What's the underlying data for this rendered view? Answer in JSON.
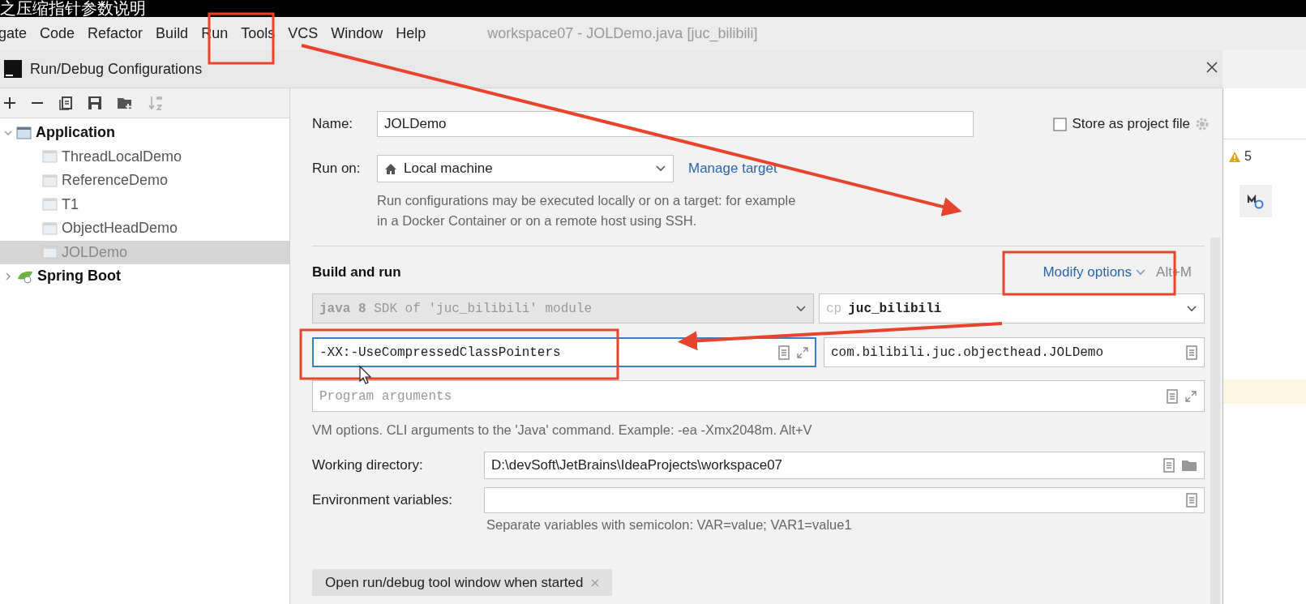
{
  "caption": "之压缩指针参数说明",
  "menu": [
    "gate",
    "Code",
    "Refactor",
    "Build",
    "Run",
    "Tools",
    "VCS",
    "Window",
    "Help"
  ],
  "ide_title": "workspace07 - JOLDemo.java [juc_bilibili]",
  "dialog": {
    "title": "Run/Debug Configurations"
  },
  "tree": [
    {
      "label": "Application",
      "kind": "app",
      "expanded": true,
      "selected": false,
      "children": [
        {
          "label": "ThreadLocalDemo",
          "selected": false
        },
        {
          "label": "ReferenceDemo",
          "selected": false
        },
        {
          "label": "T1",
          "selected": false
        },
        {
          "label": "ObjectHeadDemo",
          "selected": false
        },
        {
          "label": "JOLDemo",
          "selected": true
        }
      ]
    },
    {
      "label": "Spring Boot",
      "kind": "spring",
      "expanded": false,
      "selected": false
    }
  ],
  "form": {
    "name_label": "Name:",
    "name_value": "JOLDemo",
    "store_label": "Store as project file",
    "store_checked": false,
    "run_on_label": "Run on:",
    "run_on_value": "Local machine",
    "manage_link": "Manage target",
    "run_on_hint": "Run configurations may be executed locally or on a target: for example in a Docker Container or on a remote host using SSH.",
    "section": "Build and run",
    "modify_options": "Modify options",
    "modify_shortcut": "Alt+M",
    "sdk": "**java 8** SDK of 'juc_bilibili' module",
    "cp_prefix": "cp",
    "cp_value": "juc_bilibili",
    "vm_options": "-XX:-UseCompressedClassPointers",
    "main_class": "com.bilibili.juc.objecthead.JOLDemo",
    "program_args_placeholder": "Program arguments",
    "vm_hint": "VM options. CLI arguments to the 'Java' command. Example: -ea -Xmx2048m. Alt+V",
    "workdir_label": "Working directory:",
    "workdir_value": "D:\\devSoft\\JetBrains\\IdeaProjects\\workspace07",
    "env_label": "Environment variables:",
    "env_hint": "Separate variables with semicolon: VAR=value; VAR1=value1",
    "tag": "Open run/debug tool window when started"
  },
  "side": {
    "warnings": "5"
  }
}
